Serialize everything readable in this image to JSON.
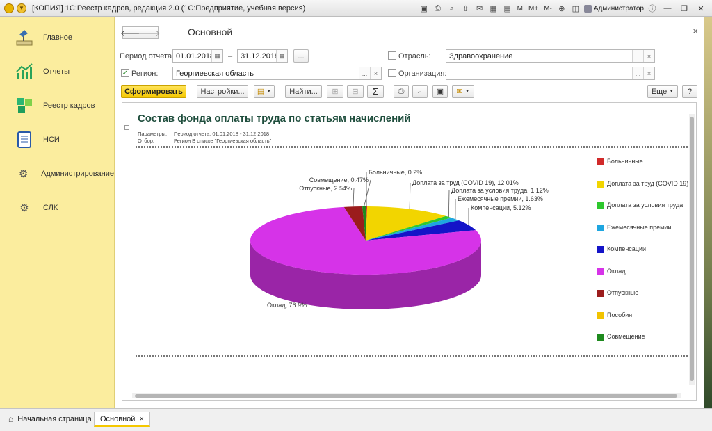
{
  "window": {
    "title": "[КОПИЯ] 1С:Реестр кадров, редакция 2.0  (1С:Предприятие, учебная версия)",
    "tools": {
      "m": "M",
      "mplus": "M+",
      "mminus": "M-"
    },
    "user": "Администратор"
  },
  "sidebar": {
    "items": [
      {
        "label": "Главное",
        "icon": "desk-lamp-icon"
      },
      {
        "label": "Отчеты",
        "icon": "chart-icon"
      },
      {
        "label": "Реестр кадров",
        "icon": "cubes-icon"
      },
      {
        "label": "НСИ",
        "icon": "book-icon"
      },
      {
        "label": "Администрирование",
        "icon": "gear-icon"
      },
      {
        "label": "СЛК",
        "icon": "gear-icon"
      }
    ]
  },
  "form": {
    "title": "Основной",
    "period_label": "Период отчета:",
    "period_from": "01.01.2018",
    "period_dash": "–",
    "period_to": "31.12.2018",
    "ellipsis": "...",
    "region_label": "Регион:",
    "region_checked": true,
    "region_value": "Георгиевская область",
    "industry_label": "Отрасль:",
    "industry_checked": false,
    "industry_value": "Здравоохранение",
    "org_label": "Организация:",
    "org_checked": false,
    "org_value": ""
  },
  "toolbar": {
    "generate": "Сформировать",
    "settings": "Настройки...",
    "find": "Найти...",
    "sum": "Σ",
    "more": "Еще",
    "help": "?"
  },
  "report": {
    "title": "Состав фонда оплаты труда по статьям начислений",
    "params_label": "Параметры:",
    "params_value": "Период отчета: 01.01.2018 - 31.12.2018",
    "filter_label": "Отбор:",
    "filter_value": "Регион В списке \"Георгиевская область\""
  },
  "chart_data": {
    "type": "pie",
    "style": "3d",
    "legend_position": "right",
    "series": [
      {
        "name": "Больничные",
        "value": 0.2,
        "label": "Больничные, 0.2%",
        "color": "#d12a2a"
      },
      {
        "name": "Доплата за труд  (COVID 19)",
        "value": 12.01,
        "label": "Доплата за труд  (COVID 19), 12.01%",
        "color": "#f2d500"
      },
      {
        "name": "Доплата за условия труда",
        "value": 1.12,
        "label": "Доплата за условия труда, 1.12%",
        "color": "#2ec82e"
      },
      {
        "name": "Ежемесячные премии",
        "value": 1.63,
        "label": "Ежемесячные премии, 1.63%",
        "color": "#1ea6e0"
      },
      {
        "name": "Компенсации",
        "value": 5.12,
        "label": "Компенсации, 5.12%",
        "color": "#1414c8"
      },
      {
        "name": "Оклад",
        "value": 76.9,
        "label": "Оклад, 76.9%",
        "color": "#d633e8"
      },
      {
        "name": "Отпускные",
        "value": 2.54,
        "label": "Отпускные, 2.54%",
        "color": "#9b1c1c"
      },
      {
        "name": "Пособия",
        "value": 0.0,
        "label": "",
        "color": "#f2c300"
      },
      {
        "name": "Совмещение",
        "value": 0.47,
        "label": "Совмещение, 0.47%",
        "color": "#1e8a1e"
      }
    ]
  },
  "tabs": [
    {
      "label": "Начальная страница",
      "icon": "home-icon"
    },
    {
      "label": "Основной",
      "close": "×"
    }
  ]
}
